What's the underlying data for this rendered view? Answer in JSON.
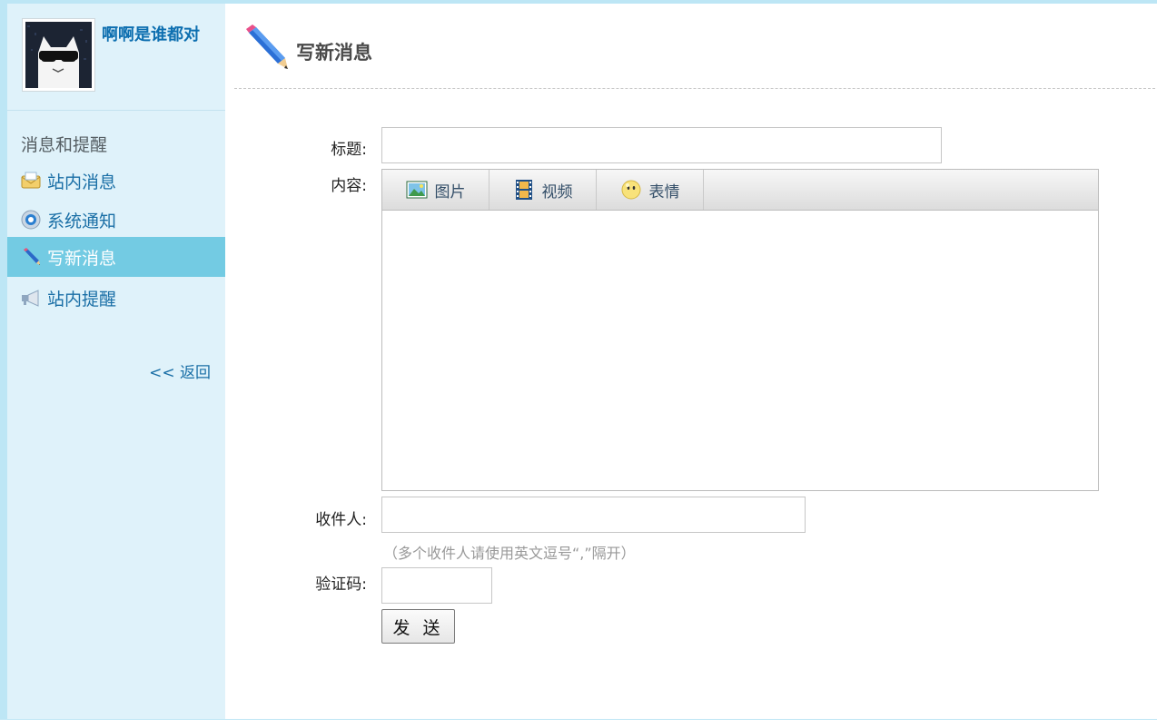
{
  "profile": {
    "username": "啊啊是谁都对"
  },
  "sidebar": {
    "heading": "消息和提醒",
    "items": [
      {
        "label": "站内消息",
        "icon": "envelope-icon",
        "active": false
      },
      {
        "label": "系统通知",
        "icon": "notification-icon",
        "active": false
      },
      {
        "label": "写新消息",
        "icon": "pencil-icon",
        "active": true
      },
      {
        "label": "站内提醒",
        "icon": "megaphone-icon",
        "active": false
      }
    ],
    "back_label": "<< 返回"
  },
  "page": {
    "title": "写新消息",
    "icon": "pencil-icon"
  },
  "form": {
    "title_label": "标题:",
    "title_value": "",
    "content_label": "内容:",
    "toolbar": [
      {
        "label": "图片",
        "icon": "image-icon"
      },
      {
        "label": "视频",
        "icon": "film-icon"
      },
      {
        "label": "表情",
        "icon": "smiley-icon"
      }
    ],
    "content_value": "",
    "recipient_label": "收件人:",
    "recipient_value": "",
    "recipient_hint": "（多个收件人请使用英文逗号“,”隔开）",
    "captcha_label": "验证码:",
    "captcha_value": "",
    "send_label": "发 送"
  },
  "colors": {
    "sidebar_bg": "#dff2fa",
    "active_bg": "#73cbe3",
    "link": "#1a6fa6",
    "username": "#0d6fb0"
  }
}
